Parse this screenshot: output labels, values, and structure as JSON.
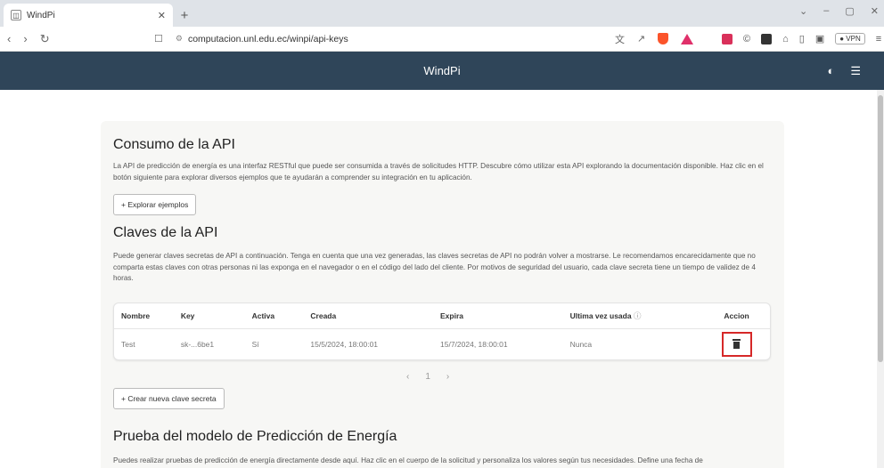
{
  "browser": {
    "tab_title": "WindPi",
    "url": "computacion.unl.edu.ec/winpi/api-keys",
    "vpn_label": "VPN"
  },
  "app": {
    "brand": "WindPi"
  },
  "section_api": {
    "title": "Consumo de la API",
    "description": "La API de predicción de energía es una interfaz RESTful que puede ser consumida a través de solicitudes HTTP. Descubre cómo utilizar esta API explorando la documentación disponible. Haz clic en el botón siguiente para explorar diversos ejemplos que te ayudarán a comprender su integración en tu aplicación.",
    "explore_button": "+ Explorar ejemplos"
  },
  "section_keys": {
    "title": "Claves de la API",
    "description": "Puede generar claves secretas de API a continuación. Tenga en cuenta que una vez generadas, las claves secretas de API no podrán volver a mostrarse. Le recomendamos encarecidamente que no comparta estas claves con otras personas ni las exponga en el navegador o en el código del lado del cliente. Por motivos de seguridad del usuario, cada clave secreta tiene un tiempo de validez de 4 horas.",
    "columns": [
      "Nombre",
      "Key",
      "Activa",
      "Creada",
      "Expira",
      "Ultima vez usada",
      "Accion"
    ],
    "rows": [
      [
        "Test",
        "sk-...6be1",
        "Sí",
        "15/5/2024, 18:00:01",
        "15/7/2024, 18:00:01",
        "Nunca"
      ]
    ],
    "page": "1",
    "create_button": "+ Crear nueva clave secreta"
  },
  "section_test": {
    "title": "Prueba del modelo de Predicción de Energía",
    "description": "Puedes realizar pruebas de predicción de energía directamente desde aquí. Haz clic en el cuerpo de la solicitud y personaliza los valores según tus necesidades. Define una fecha de"
  }
}
